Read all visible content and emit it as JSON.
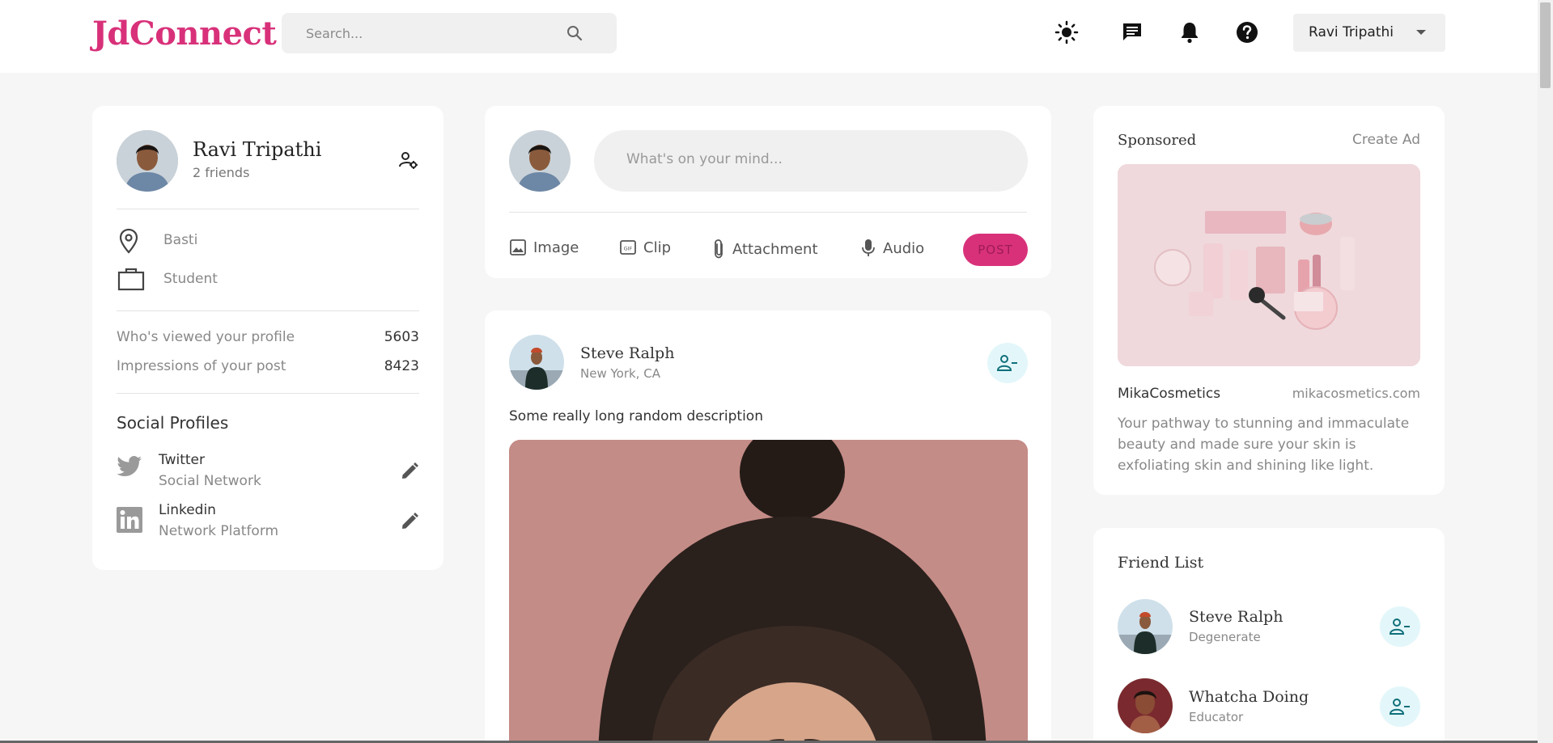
{
  "app": {
    "logo": "JdConnect"
  },
  "search": {
    "placeholder": "Search..."
  },
  "nav": {
    "icons": [
      "brightness-icon",
      "chat-icon",
      "notifications-icon",
      "help-icon"
    ],
    "user_name": "Ravi Tripathi"
  },
  "profile": {
    "name": "Ravi Tripathi",
    "friends": "2 friends",
    "location": "Basti",
    "occupation": "Student",
    "stats": [
      {
        "label": "Who's viewed your profile",
        "value": "5603"
      },
      {
        "label": "Impressions of your post",
        "value": "8423"
      }
    ],
    "social_title": "Social Profiles",
    "socials": [
      {
        "name": "Twitter",
        "sub": "Social Network"
      },
      {
        "name": "Linkedin",
        "sub": "Network Platform"
      }
    ]
  },
  "composer": {
    "placeholder": "What's on your mind...",
    "tools": [
      "Image",
      "Clip",
      "Attachment",
      "Audio"
    ],
    "post_label": "POST"
  },
  "feed": {
    "post": {
      "author": "Steve Ralph",
      "location": "New York, CA",
      "description": "Some really long random description"
    }
  },
  "sponsored": {
    "title": "Sponsored",
    "create_ad": "Create Ad",
    "brand": "MikaCosmetics",
    "url": "mikacosmetics.com",
    "description": "Your pathway to stunning and immaculate beauty and made sure your skin is exfoliating skin and shining like light."
  },
  "friend_list": {
    "title": "Friend List",
    "friends": [
      {
        "name": "Steve Ralph",
        "sub": "Degenerate"
      },
      {
        "name": "Whatcha Doing",
        "sub": "Educator"
      }
    ]
  },
  "colors": {
    "brand": "#d8317a",
    "friend_button_bg": "#e3f7fa",
    "friend_icon": "#0f6f7a"
  }
}
